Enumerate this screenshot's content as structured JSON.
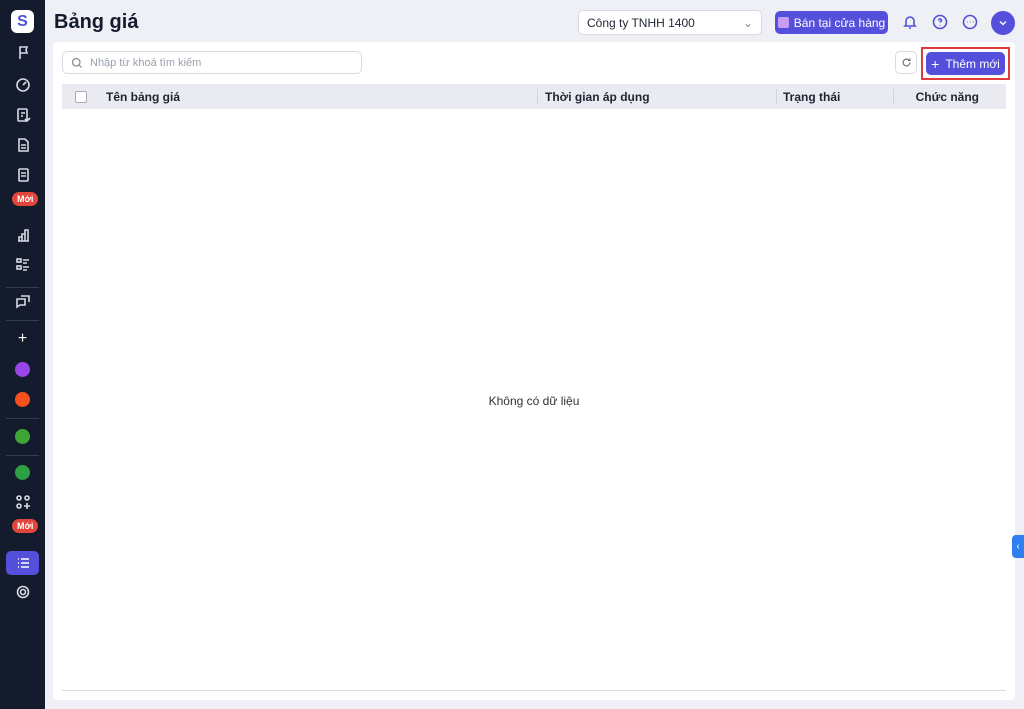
{
  "header": {
    "title": "Bảng giá",
    "company": "Công ty TNHH 1400",
    "store_button": "Bán tại cửa hàng"
  },
  "sidebar": {
    "badge_new": "Mới"
  },
  "toolbar": {
    "search_placeholder": "Nhập từ khoá tìm kiếm",
    "add_button": "Thêm mới"
  },
  "table": {
    "columns": [
      "Tên bảng giá",
      "Thời gian áp dụng",
      "Trạng thái",
      "Chức năng"
    ],
    "empty_text": "Không có dữ liệu"
  },
  "colors": {
    "sidebar": "#141b2d",
    "accent": "#5550dc",
    "badge": "#e0463c"
  }
}
